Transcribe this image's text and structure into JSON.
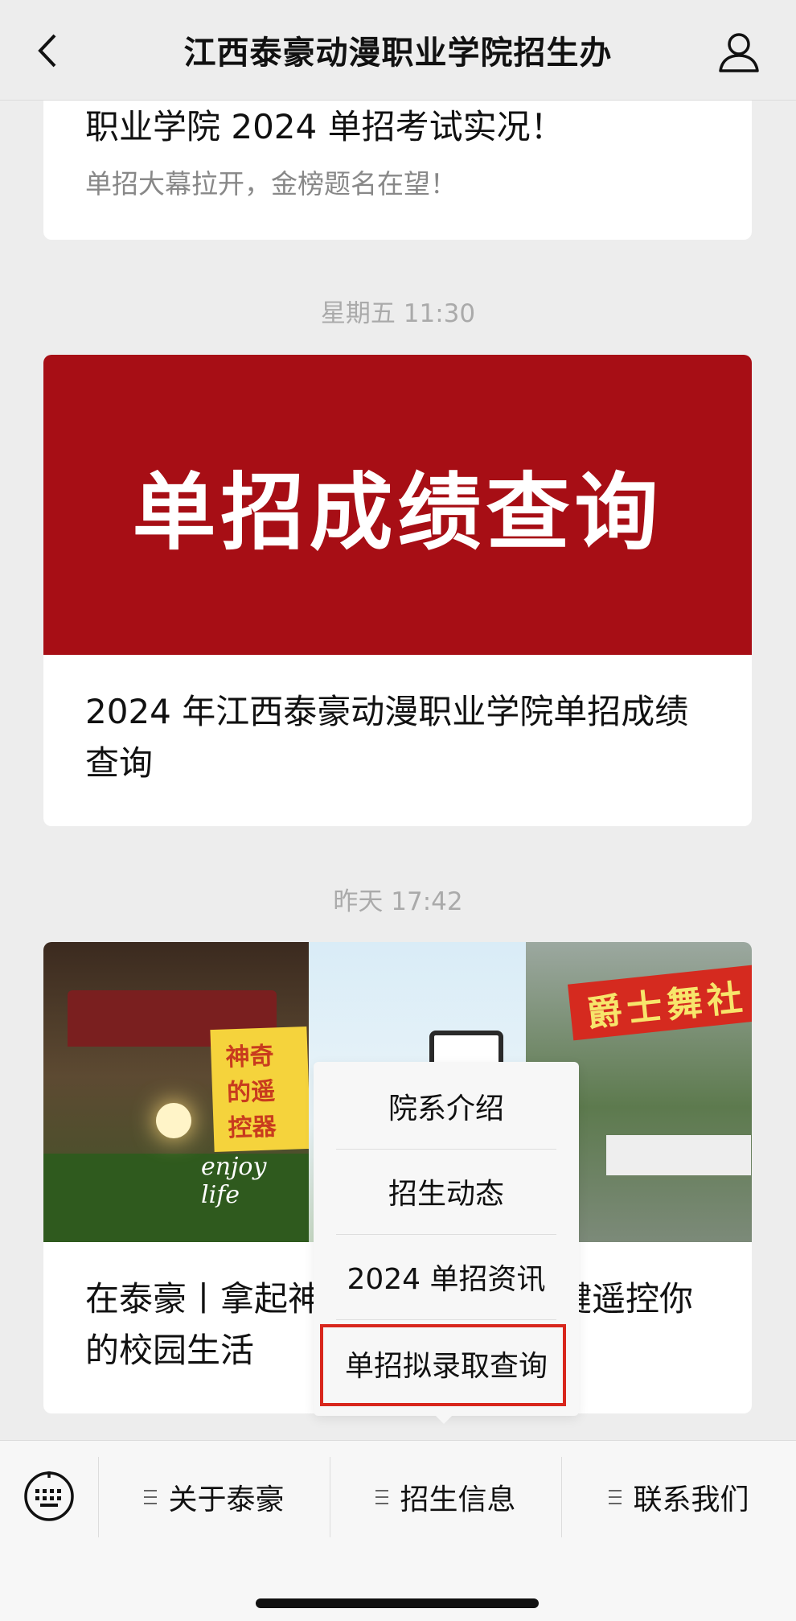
{
  "header": {
    "title": "江西泰豪动漫职业学院招生办",
    "back_icon": "chevron-left-icon",
    "profile_icon": "person-icon"
  },
  "messages": [
    {
      "title": "职业学院 2024 单招考试实况！",
      "subtitle": "单招大幕拉开，金榜题名在望！"
    },
    {
      "timestamp": "星期五 11:30",
      "banner_text": "单招成绩查询",
      "title": "2024 年江西泰豪动漫职业学院单招成绩查询"
    },
    {
      "timestamp": "昨天 17:42",
      "image_tag": "神奇的遥控器",
      "image_script_text": "enjoy life",
      "image_sign_text": "爵士舞社",
      "title": "在泰豪丨拿起神奇的遥控器，一键遥控你的校园生活"
    }
  ],
  "popup_menu": {
    "items": [
      "院系介绍",
      "招生动态",
      "2024 单招资讯",
      "单招拟录取查询"
    ],
    "highlighted_index": 3,
    "highlight_color": "#d8261c"
  },
  "bottom_bar": {
    "keyboard_icon": "keyboard-icon",
    "menus": [
      "关于泰豪",
      "招生信息",
      "联系我们"
    ]
  },
  "colors": {
    "banner_red": "#a70e15",
    "background": "#ededed"
  }
}
